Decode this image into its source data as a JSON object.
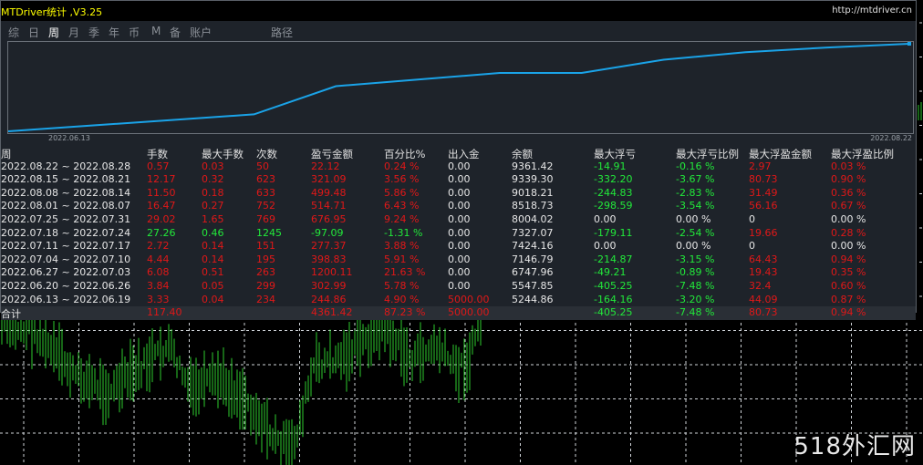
{
  "app": {
    "title": "MTDriver统计 ,V3.25",
    "url": "http://mtdriver.cn"
  },
  "tabs": [
    {
      "label": "综",
      "active": false
    },
    {
      "label": "日",
      "active": false
    },
    {
      "label": "周",
      "active": true
    },
    {
      "label": "月",
      "active": false
    },
    {
      "label": "季",
      "active": false
    },
    {
      "label": "年",
      "active": false
    },
    {
      "label": "币",
      "active": false
    },
    {
      "label": "M",
      "active": false
    },
    {
      "label": "备",
      "active": false
    },
    {
      "label": "账户",
      "active": false
    },
    {
      "label": "路径",
      "active": false
    }
  ],
  "equity_chart": {
    "start_date": "2022.06.13",
    "end_date": "2022.08.22",
    "line_color": "#1aa3e8",
    "series": [
      0,
      6,
      12,
      18,
      48,
      55,
      62,
      62,
      76,
      84,
      89,
      93
    ]
  },
  "table": {
    "headers": [
      "周",
      "手数",
      "最大手数",
      "次数",
      "盈亏金额",
      "百分比%",
      "出入金",
      "余额",
      "最大浮亏",
      "最大浮亏比例",
      "最大浮盈金额",
      "最大浮盈比例"
    ],
    "rows": [
      [
        "2022.08.22 ~ 2022.08.28",
        "0.57",
        "0.03",
        "50",
        "22.12",
        "0.24 %",
        "0.00",
        "9361.42",
        "-14.91",
        "-0.16 %",
        "2.97",
        "0.03 %"
      ],
      [
        "2022.08.15 ~ 2022.08.21",
        "12.17",
        "0.32",
        "623",
        "321.09",
        "3.56 %",
        "0.00",
        "9339.30",
        "-332.20",
        "-3.67 %",
        "80.73",
        "0.90 %"
      ],
      [
        "2022.08.08 ~ 2022.08.14",
        "11.50",
        "0.18",
        "633",
        "499.48",
        "5.86 %",
        "0.00",
        "9018.21",
        "-244.83",
        "-2.83 %",
        "31.49",
        "0.36 %"
      ],
      [
        "2022.08.01 ~ 2022.08.07",
        "16.47",
        "0.27",
        "752",
        "514.71",
        "6.43 %",
        "0.00",
        "8518.73",
        "-298.59",
        "-3.54 %",
        "56.16",
        "0.67 %"
      ],
      [
        "2022.07.25 ~ 2022.07.31",
        "29.02",
        "1.65",
        "769",
        "676.95",
        "9.24 %",
        "0.00",
        "8004.02",
        "0.00",
        "0.00 %",
        "0",
        "0.00 %"
      ],
      [
        "2022.07.18 ~ 2022.07.24",
        "27.26",
        "0.46",
        "1245",
        "-97.09",
        "-1.31 %",
        "0.00",
        "7327.07",
        "-179.11",
        "-2.54 %",
        "19.66",
        "0.28 %"
      ],
      [
        "2022.07.11 ~ 2022.07.17",
        "2.72",
        "0.14",
        "151",
        "277.37",
        "3.88 %",
        "0.00",
        "7424.16",
        "0.00",
        "0.00 %",
        "0",
        "0.00 %"
      ],
      [
        "2022.07.04 ~ 2022.07.10",
        "4.44",
        "0.14",
        "195",
        "398.83",
        "5.91 %",
        "0.00",
        "7146.79",
        "-214.87",
        "-3.15 %",
        "64.43",
        "0.94 %"
      ],
      [
        "2022.06.27 ~ 2022.07.03",
        "6.08",
        "0.51",
        "263",
        "1200.11",
        "21.63 %",
        "0.00",
        "6747.96",
        "-49.21",
        "-0.89 %",
        "19.43",
        "0.35 %"
      ],
      [
        "2022.06.20 ~ 2022.06.26",
        "3.84",
        "0.05",
        "299",
        "302.99",
        "5.78 %",
        "0.00",
        "5547.85",
        "-405.25",
        "-7.48 %",
        "32.4",
        "0.60 %"
      ],
      [
        "2022.06.13 ~ 2022.06.19",
        "3.33",
        "0.04",
        "234",
        "244.86",
        "4.90 %",
        "5000.00",
        "5244.86",
        "-164.16",
        "-3.20 %",
        "44.09",
        "0.87 %"
      ]
    ],
    "row_colors": [
      [
        "wht",
        "red",
        "red",
        "red",
        "red",
        "red",
        "wht",
        "wht",
        "grn",
        "grn",
        "red",
        "red"
      ],
      [
        "wht",
        "red",
        "red",
        "red",
        "red",
        "red",
        "wht",
        "wht",
        "grn",
        "grn",
        "red",
        "red"
      ],
      [
        "wht",
        "red",
        "red",
        "red",
        "red",
        "red",
        "wht",
        "wht",
        "grn",
        "grn",
        "red",
        "red"
      ],
      [
        "wht",
        "red",
        "red",
        "red",
        "red",
        "red",
        "wht",
        "wht",
        "grn",
        "grn",
        "red",
        "red"
      ],
      [
        "wht",
        "red",
        "red",
        "red",
        "red",
        "red",
        "wht",
        "wht",
        "wht",
        "wht",
        "wht",
        "wht"
      ],
      [
        "wht",
        "grn",
        "grn",
        "grn",
        "grn",
        "grn",
        "wht",
        "wht",
        "grn",
        "grn",
        "red",
        "red"
      ],
      [
        "wht",
        "red",
        "red",
        "red",
        "red",
        "red",
        "wht",
        "wht",
        "wht",
        "wht",
        "wht",
        "wht"
      ],
      [
        "wht",
        "red",
        "red",
        "red",
        "red",
        "red",
        "wht",
        "wht",
        "grn",
        "grn",
        "red",
        "red"
      ],
      [
        "wht",
        "red",
        "red",
        "red",
        "red",
        "red",
        "wht",
        "wht",
        "grn",
        "grn",
        "red",
        "red"
      ],
      [
        "wht",
        "red",
        "red",
        "red",
        "red",
        "red",
        "wht",
        "wht",
        "grn",
        "grn",
        "red",
        "red"
      ],
      [
        "wht",
        "red",
        "red",
        "red",
        "red",
        "red",
        "red",
        "wht",
        "grn",
        "grn",
        "red",
        "red"
      ]
    ],
    "total": [
      "合计",
      "117.40",
      "",
      "",
      "4361.42",
      "87.23 %",
      "5000.00",
      "",
      "-405.25",
      "-7.48 %",
      "80.73",
      "0.94 %"
    ],
    "total_colors": [
      "wht",
      "red",
      "red",
      "red",
      "red",
      "red",
      "red",
      "wht",
      "grn",
      "grn",
      "red",
      "red"
    ]
  },
  "watermark": "518外汇网",
  "colors": {
    "up": "#e01818",
    "down": "#22e83a",
    "panel": "#1e232a",
    "candles": "#2ecc2e"
  }
}
